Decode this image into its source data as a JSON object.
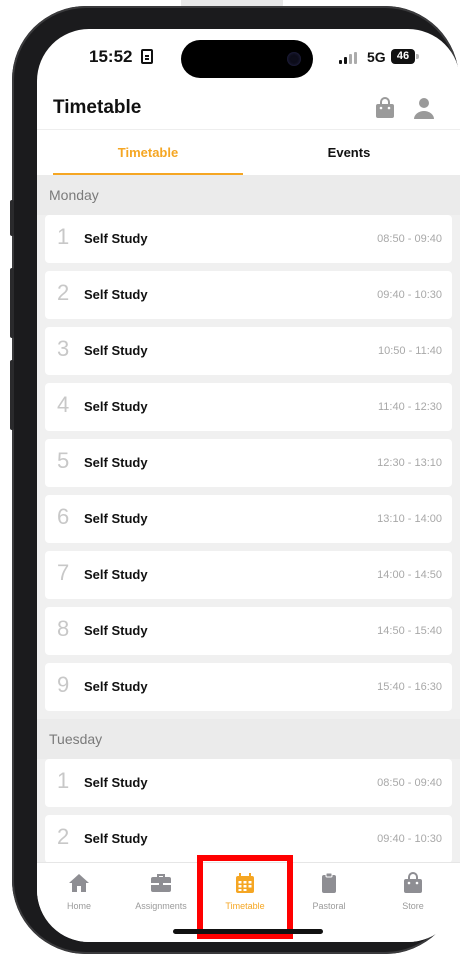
{
  "status_bar": {
    "time": "15:52",
    "network": "5G",
    "battery": "46"
  },
  "header": {
    "title": "Timetable"
  },
  "tabs": [
    {
      "label": "Timetable",
      "active": true
    },
    {
      "label": "Events",
      "active": false
    }
  ],
  "days": [
    {
      "name": "Monday",
      "lessons": [
        {
          "number": "1",
          "title": "Self Study",
          "time": "08:50 - 09:40"
        },
        {
          "number": "2",
          "title": "Self Study",
          "time": "09:40 - 10:30"
        },
        {
          "number": "3",
          "title": "Self Study",
          "time": "10:50 - 11:40"
        },
        {
          "number": "4",
          "title": "Self Study",
          "time": "11:40 - 12:30"
        },
        {
          "number": "5",
          "title": "Self Study",
          "time": "12:30 - 13:10"
        },
        {
          "number": "6",
          "title": "Self Study",
          "time": "13:10 - 14:00"
        },
        {
          "number": "7",
          "title": "Self Study",
          "time": "14:00 - 14:50"
        },
        {
          "number": "8",
          "title": "Self Study",
          "time": "14:50 - 15:40"
        },
        {
          "number": "9",
          "title": "Self Study",
          "time": "15:40 - 16:30"
        }
      ]
    },
    {
      "name": "Tuesday",
      "lessons": [
        {
          "number": "1",
          "title": "Self Study",
          "time": "08:50 - 09:40"
        },
        {
          "number": "2",
          "title": "Self Study",
          "time": "09:40 - 10:30"
        }
      ]
    }
  ],
  "bottom_nav": [
    {
      "label": "Home",
      "icon": "home-icon",
      "active": false
    },
    {
      "label": "Assignments",
      "icon": "briefcase-icon",
      "active": false
    },
    {
      "label": "Timetable",
      "icon": "calendar-icon",
      "active": true
    },
    {
      "label": "Pastoral",
      "icon": "clipboard-icon",
      "active": false
    },
    {
      "label": "Store",
      "icon": "shopping-bag-icon",
      "active": false
    }
  ],
  "colors": {
    "accent": "#f5a623",
    "highlight": "#ff0000"
  }
}
